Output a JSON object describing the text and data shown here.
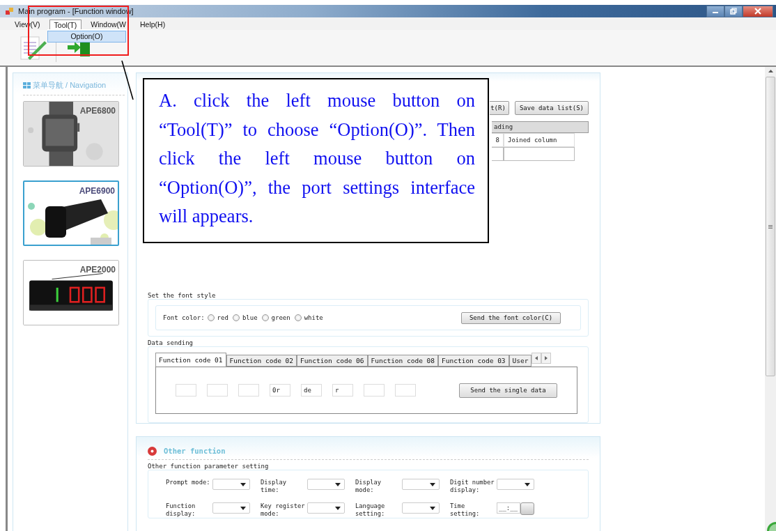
{
  "window": {
    "title": "Main program - [Function window]"
  },
  "menu": [
    {
      "label": "View(V)",
      "selected": false
    },
    {
      "label": "Tool(T)",
      "selected": true
    },
    {
      "label": "Window(W",
      "selected": false
    },
    {
      "label": "Help(H)",
      "selected": false
    }
  ],
  "dropdown": {
    "items": [
      {
        "label": "Option(O)",
        "selected": true
      }
    ]
  },
  "navigation": {
    "title": "菜单导航 / Navigation",
    "items": [
      {
        "label": "APE6800",
        "selected": false
      },
      {
        "label": "APE6900",
        "selected": true
      },
      {
        "label": "APE2000",
        "selected": false
      }
    ]
  },
  "data_panel": {
    "buttons": [
      "t(R)",
      "Save data list(S)"
    ],
    "list_header": "ading",
    "columns": [
      "8",
      "Joined column"
    ]
  },
  "font_style": {
    "title": "Set the font style",
    "label": "Font color:",
    "options": [
      {
        "label": "red",
        "checked": false
      },
      {
        "label": "blue",
        "checked": false
      },
      {
        "label": "green",
        "checked": false
      },
      {
        "label": "white",
        "checked": false
      }
    ],
    "button": "Send the font color(C)"
  },
  "data_sending": {
    "title": "Data sending",
    "tabs": [
      {
        "label": "Function code 01",
        "selected": true
      },
      {
        "label": "Function code 02",
        "selected": false
      },
      {
        "label": "Function code 06",
        "selected": false
      },
      {
        "label": "Function code 08",
        "selected": false
      },
      {
        "label": "Function code 03",
        "selected": false
      },
      {
        "label": "User",
        "selected": false
      }
    ],
    "fields": [
      {
        "kind": "blank"
      },
      {
        "kind": "blank"
      },
      {
        "kind": "blank"
      },
      {
        "kind": "text",
        "value": "0r"
      },
      {
        "kind": "text",
        "value": "de"
      },
      {
        "kind": "text",
        "value": "r"
      },
      {
        "kind": "blank"
      },
      {
        "kind": "blank"
      }
    ],
    "button": "Send the single data"
  },
  "other_function": {
    "title": "Other function",
    "group_title": "Other function parameter setting",
    "settings": [
      {
        "label": "Prompt mode:",
        "kind": "select"
      },
      {
        "label": "Display time:",
        "kind": "select"
      },
      {
        "label": "Display mode:",
        "kind": "select"
      },
      {
        "label": "Digit number display:",
        "kind": "select"
      },
      {
        "label": "Function display:",
        "kind": "select"
      },
      {
        "label": "Key register mode:",
        "kind": "select"
      },
      {
        "label": "Language setting:",
        "kind": "select"
      },
      {
        "label": "Time setting:",
        "kind": "time",
        "value": "__:__"
      }
    ]
  },
  "annotation": {
    "text": "A. click the left mouse button on “Tool(T)” to choose “Option(O)”. Then click the left mouse button on “Option(O)”, the port settings interface will appears."
  }
}
